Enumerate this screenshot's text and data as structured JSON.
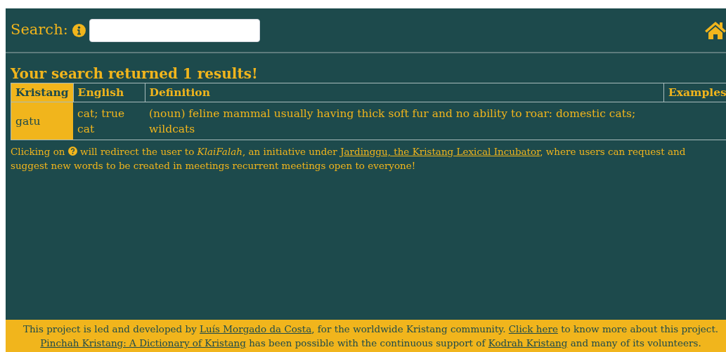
{
  "search": {
    "label": "Search:"
  },
  "heading": "Your search returned 1 results!",
  "table": {
    "columns": [
      "Kristang",
      "English",
      "Definition",
      "Examples"
    ],
    "rows": [
      {
        "cells": [
          "gatu",
          "cat; true cat",
          "(noun) feline mammal usually having thick soft fur and no ability to roar: domestic cats; wildcats",
          ""
        ]
      }
    ]
  },
  "note": {
    "lead": "Clicking on",
    "middle": "will redirect the user to *KlaiFalah*, an initiative under",
    "link": "Jardinggu, the Kristang Lexical Incubator",
    "tail": ", where users can request and suggest new words to be created in meetings recurrent meetings open to everyone!"
  },
  "footer": {
    "lines": [
      [
        {
          "kind": "text",
          "text": "This project is led and developed by"
        },
        {
          "kind": "link",
          "text": "Luís Morgado da Costa"
        },
        {
          "kind": "text",
          "text": ", for the worldwide Kristang community."
        },
        {
          "kind": "link",
          "text": "Click here"
        },
        {
          "kind": "text",
          "text": "to know more about this project."
        }
      ],
      [
        {
          "kind": "link",
          "text": "Pinchah Kristang: A Dictionary of Kristang"
        },
        {
          "kind": "text",
          "text": "has been possible with the continuous support of"
        },
        {
          "kind": "link",
          "text": "Kodrah Kristang"
        },
        {
          "kind": "text",
          "text": "and many of its volunteers."
        }
      ]
    ]
  }
}
